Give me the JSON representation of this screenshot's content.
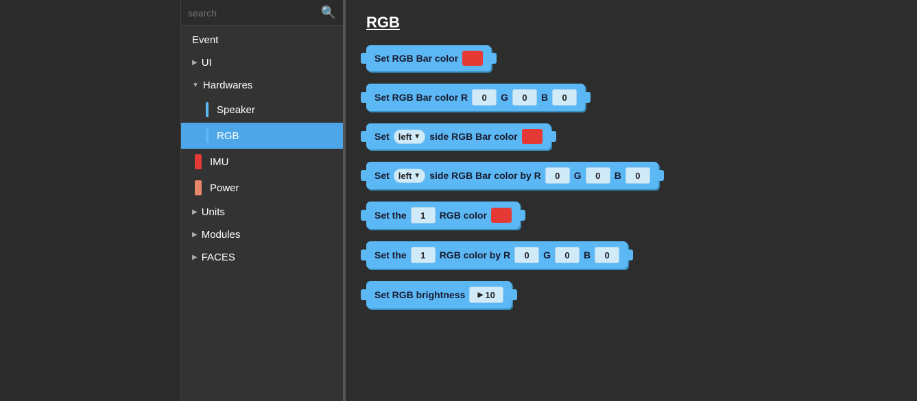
{
  "search": {
    "placeholder": "search",
    "icon": "🔍"
  },
  "sidebar": {
    "items": [
      {
        "id": "event",
        "label": "Event",
        "type": "top",
        "indent": 0,
        "arrow": ""
      },
      {
        "id": "ui",
        "label": "UI",
        "type": "collapsed",
        "indent": 0,
        "arrow": "▶"
      },
      {
        "id": "hardwares",
        "label": "Hardwares",
        "type": "expanded",
        "indent": 0,
        "arrow": "▼"
      },
      {
        "id": "speaker",
        "label": "Speaker",
        "type": "sub",
        "indent": 1,
        "colorBar": "#5bb8f5"
      },
      {
        "id": "rgb",
        "label": "RGB",
        "type": "sub-active",
        "indent": 1,
        "colorBar": "#5bb8f5"
      },
      {
        "id": "imu",
        "label": "IMU",
        "type": "sub",
        "indent": 0,
        "colorBar": "#e53935"
      },
      {
        "id": "power",
        "label": "Power",
        "type": "sub",
        "indent": 0,
        "colorBar": "#e8876a"
      },
      {
        "id": "units",
        "label": "Units",
        "type": "collapsed",
        "indent": 0,
        "arrow": "▶"
      },
      {
        "id": "modules",
        "label": "Modules",
        "type": "collapsed",
        "indent": 0,
        "arrow": "▶"
      },
      {
        "id": "faces",
        "label": "FACES",
        "type": "collapsed",
        "indent": 0,
        "arrow": "▶"
      }
    ]
  },
  "main": {
    "title": "RGB",
    "blocks": [
      {
        "id": "block1",
        "text_before": "Set RGB Bar color",
        "has_color": true,
        "color": "red"
      },
      {
        "id": "block2",
        "text_before": "Set RGB Bar color R",
        "inputs": [
          {
            "id": "r",
            "value": "0"
          },
          {
            "label": "G"
          },
          {
            "id": "g",
            "value": "0"
          },
          {
            "label": "B"
          },
          {
            "id": "b",
            "value": "0"
          }
        ]
      },
      {
        "id": "block3",
        "text_before": "Set",
        "dropdown": "left",
        "text_after": "side RGB Bar color",
        "has_color": true,
        "color": "red"
      },
      {
        "id": "block4",
        "text_before": "Set",
        "dropdown": "left",
        "text_after": "side RGB Bar color by R",
        "inputs": [
          {
            "id": "r",
            "value": "0"
          },
          {
            "label": "G"
          },
          {
            "id": "g",
            "value": "0"
          },
          {
            "label": "B"
          },
          {
            "id": "b",
            "value": "0"
          }
        ]
      },
      {
        "id": "block5",
        "text_before": "Set the",
        "number_input": "1",
        "text_after": "RGB color",
        "has_color": true,
        "color": "red"
      },
      {
        "id": "block6",
        "text_before": "Set the",
        "number_input": "1",
        "text_after": "RGB color by R",
        "inputs": [
          {
            "id": "r",
            "value": "0"
          },
          {
            "label": "G"
          },
          {
            "id": "g",
            "value": "0"
          },
          {
            "label": "B"
          },
          {
            "id": "b",
            "value": "0"
          }
        ]
      },
      {
        "id": "block7",
        "text_before": "Set RGB brightness",
        "number_input": "10"
      }
    ]
  },
  "colors": {
    "accent_blue": "#5bb8f5",
    "sidebar_bg": "#333333",
    "main_bg": "#2d2d2d",
    "active_item": "#4da6e8",
    "red_swatch": "#e53935"
  }
}
